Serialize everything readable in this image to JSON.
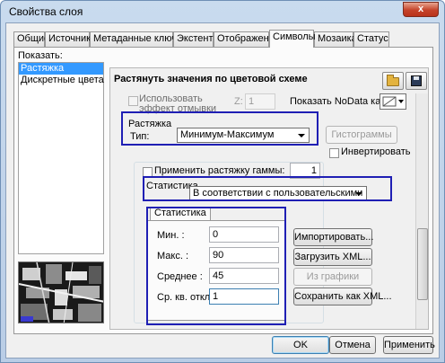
{
  "window": {
    "title": "Свойства слоя",
    "close_glyph": "x"
  },
  "tabs": [
    {
      "label": "Общие"
    },
    {
      "label": "Источник"
    },
    {
      "label": "Метаданные ключа"
    },
    {
      "label": "Экстент"
    },
    {
      "label": "Отображение"
    },
    {
      "label": "Символы",
      "active": true
    },
    {
      "label": "Мозаика"
    },
    {
      "label": "Статус"
    }
  ],
  "left": {
    "show_label": "Показать:",
    "items": [
      {
        "label": "Растяжка",
        "selected": true
      },
      {
        "label": "Дискретные цвета",
        "selected": false
      }
    ]
  },
  "renderer": {
    "title": "Растянуть значения по цветовой схеме",
    "open_icon": "folder-icon",
    "save_icon": "save-icon"
  },
  "hillshade": {
    "label_line1": "Использовать",
    "label_line2": "эффект отмывки",
    "z_label": "Z:",
    "z_value": "1"
  },
  "nodata": {
    "label": "Показать NoData как"
  },
  "stretch": {
    "group_label": "Растяжка",
    "type_label": "Тип:",
    "type_value": "Минимум-Максимум",
    "histograms_button": "Гистограммы",
    "invert_label": "Инвертировать"
  },
  "gamma": {
    "label": "Применить растяжку гаммы:",
    "value": "1"
  },
  "statistics": {
    "group_label": "Статистика",
    "mode_value": "В соответствии с пользовательскими настр",
    "tab_label": "Статистика",
    "rows": [
      {
        "label": "Мин. :",
        "value": "0"
      },
      {
        "label": "Макс. :",
        "value": "90"
      },
      {
        "label": "Среднее :",
        "value": "45"
      },
      {
        "label": "Ср. кв. откл. :",
        "value": "1"
      }
    ],
    "import_button": "Импортировать...",
    "load_xml_button": "Загрузить XML...",
    "from_graph_button": "Из графики",
    "save_xml_button": "Сохранить как XML..."
  },
  "footer": {
    "ok": "OK",
    "cancel": "Отмена",
    "apply": "Применить"
  },
  "colors": {
    "highlight": "#1f1fb4",
    "selection": "#3399ff"
  }
}
